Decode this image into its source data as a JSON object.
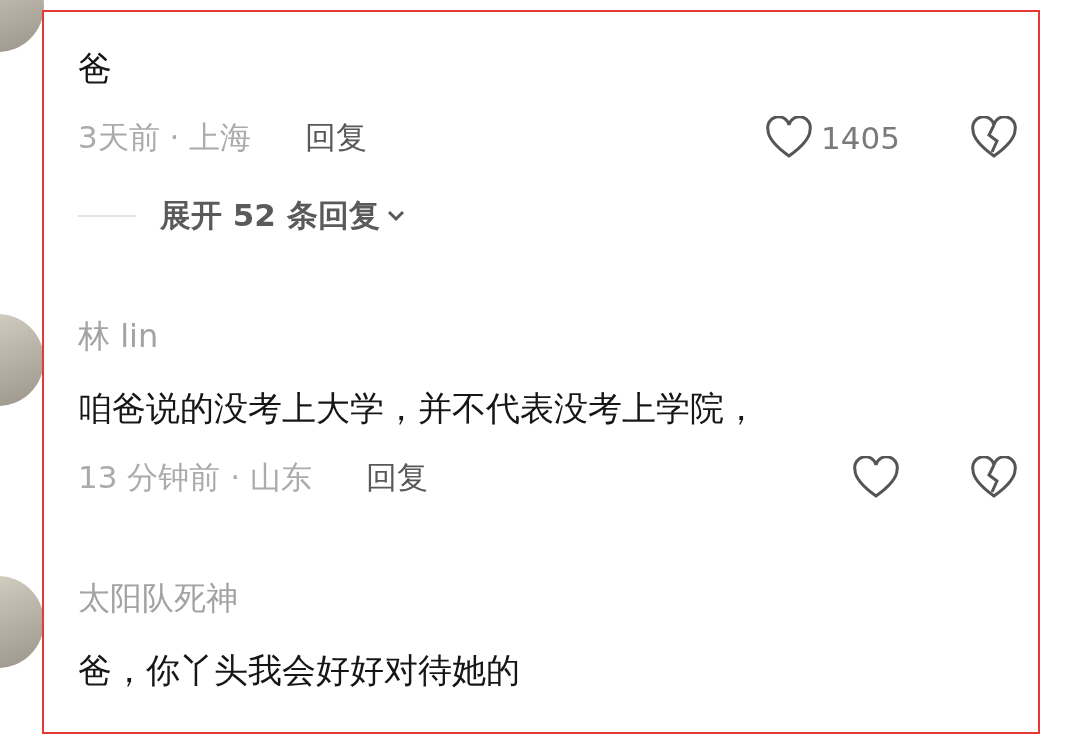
{
  "comments": [
    {
      "text": "爸",
      "time_location": "3天前 · 上海",
      "reply_label": "回复",
      "like_count": "1405",
      "expand_label": "展开 52 条回复"
    },
    {
      "username": "林 lin",
      "text": "咱爸说的没考上大学，并不代表没考上学院，",
      "time_location": "13 分钟前 · 山东",
      "reply_label": "回复"
    },
    {
      "username": "太阳队死神",
      "text": "爸，你丫头我会好好对待她的"
    }
  ]
}
